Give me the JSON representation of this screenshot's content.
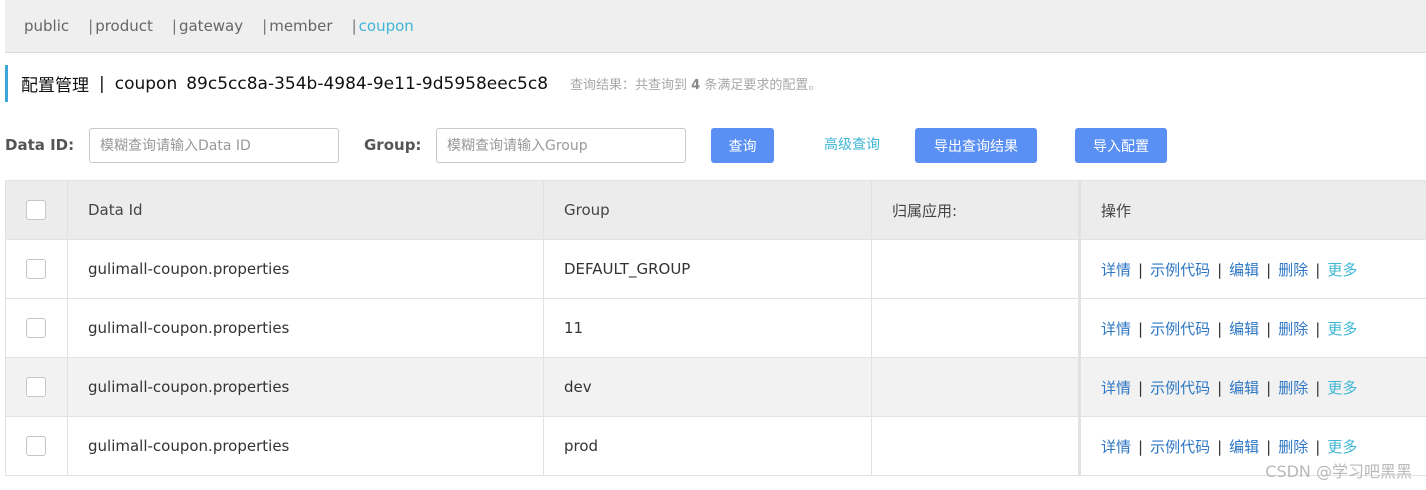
{
  "namespaces": [
    {
      "label": "public",
      "active": false
    },
    {
      "label": "product",
      "active": false
    },
    {
      "label": "gateway",
      "active": false
    },
    {
      "label": "member",
      "active": false
    },
    {
      "label": "coupon",
      "active": true
    }
  ],
  "namespace_separator": "|",
  "title": {
    "main": "配置管理",
    "separator": "|",
    "namespace": "coupon",
    "namespace_id": "89c5cc8a-354b-4984-9e11-9d5958eec5c8",
    "result_prefix": "查询结果：共查询到",
    "result_count": "4",
    "result_suffix": "条满足要求的配置。"
  },
  "search": {
    "data_id_label": "Data ID:",
    "data_id_placeholder": "模糊查询请输入Data ID",
    "group_label": "Group:",
    "group_placeholder": "模糊查询请输入Group",
    "query_button": "查询",
    "advanced_query": "高级查询",
    "export_button": "导出查询结果",
    "import_button": "导入配置"
  },
  "table": {
    "headers": {
      "data_id": "Data Id",
      "group": "Group",
      "app": "归属应用:",
      "ops": "操作"
    },
    "rows": [
      {
        "data_id": "gulimall-coupon.properties",
        "group": "DEFAULT_GROUP",
        "app": ""
      },
      {
        "data_id": "gulimall-coupon.properties",
        "group": "11",
        "app": ""
      },
      {
        "data_id": "gulimall-coupon.properties",
        "group": "dev",
        "app": ""
      },
      {
        "data_id": "gulimall-coupon.properties",
        "group": "prod",
        "app": ""
      }
    ],
    "actions": {
      "detail": "详情",
      "sample": "示例代码",
      "edit": "编辑",
      "delete": "删除",
      "more": "更多",
      "separator": "|"
    }
  },
  "watermark": "CSDN @学习吧黑黑",
  "colors": {
    "accent": "#5a8ff3",
    "link": "#2e77c4",
    "active_tab": "#3fb6d6"
  }
}
